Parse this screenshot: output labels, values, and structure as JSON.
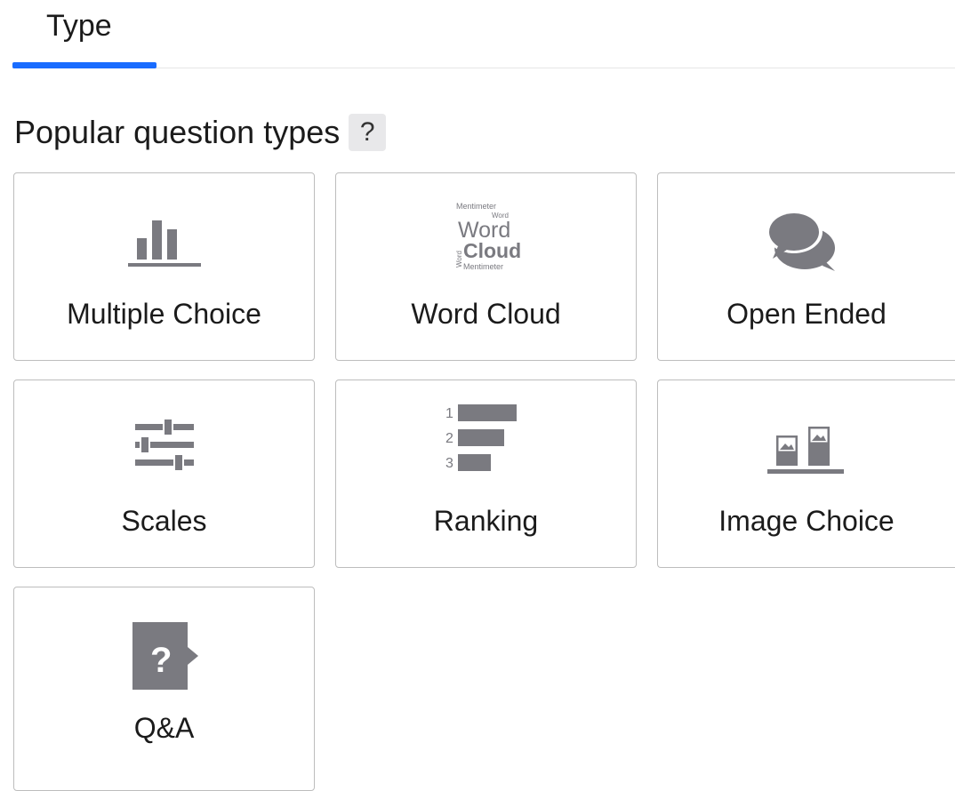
{
  "tabs": [
    {
      "label": "Type",
      "active": true
    }
  ],
  "section": {
    "title": "Popular question types",
    "help_label": "?"
  },
  "cards": [
    {
      "label": "Multiple Choice",
      "icon": "bar-chart-icon"
    },
    {
      "label": "Word Cloud",
      "icon": "word-cloud-icon"
    },
    {
      "label": "Open Ended",
      "icon": "chat-bubbles-icon"
    },
    {
      "label": "Scales",
      "icon": "sliders-icon"
    },
    {
      "label": "Ranking",
      "icon": "ranking-icon"
    },
    {
      "label": "Image Choice",
      "icon": "image-choice-icon"
    },
    {
      "label": "Q&A",
      "icon": "qa-icon"
    }
  ],
  "word_cloud_icon": {
    "small_top": "Mentimeter",
    "small_mid": "Word",
    "big_1": "Word",
    "big_2": "Cloud",
    "side": "Word",
    "bottom": "Mentimeter"
  },
  "ranking_icon": {
    "numbers": [
      "1",
      "2",
      "3"
    ]
  },
  "qa_icon": {
    "glyph": "?"
  },
  "colors": {
    "accent": "#196cff",
    "icon_gray": "#7a7a80",
    "border": "#bdbdbd"
  }
}
